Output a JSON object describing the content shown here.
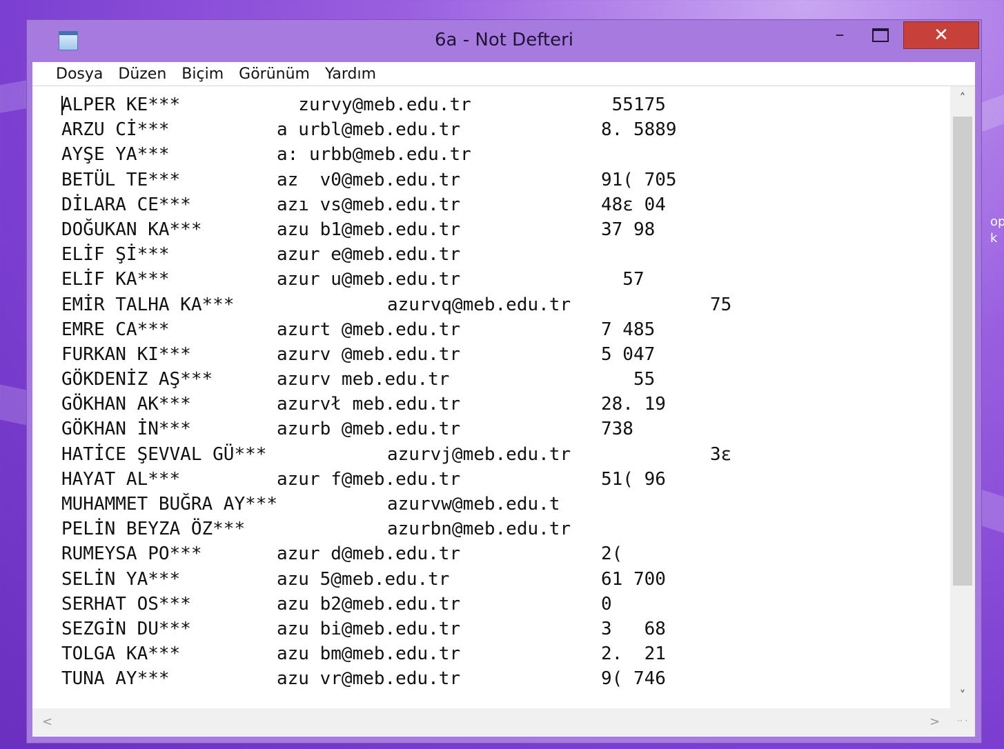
{
  "window": {
    "title": "6a - Not Defteri",
    "min_glyph": "–",
    "close_glyph": "✕"
  },
  "menu": [
    "Dosya",
    "Düzen",
    "Biçim",
    "Görünüm",
    "Yardım"
  ],
  "rows": [
    {
      "name": "ALPER KE***",
      "email": "  zurvy@meb.edu.tr",
      "num": " 55175"
    },
    {
      "name": "ARZU Cİ***",
      "email": "a urbl@meb.edu.tr",
      "num": "8. 5889"
    },
    {
      "name": "AYŞE YA***",
      "email": "a: urbb@meb.edu.tr",
      "num": ""
    },
    {
      "name": "BETÜL TE***",
      "email": "az  v0@meb.edu.tr",
      "num": "91( 705"
    },
    {
      "name": "DİLARA CE***",
      "email": "azı vs@meb.edu.tr",
      "num": "48ε 04"
    },
    {
      "name": "DOĞUKAN KA***",
      "email": "azu b1@meb.edu.tr",
      "num": "37 98"
    },
    {
      "name": "ELİF Şİ***",
      "email": "azur e@meb.edu.tr",
      "num": ""
    },
    {
      "name": "ELİF KA***",
      "email": "azur u@meb.edu.tr",
      "num": "  57"
    },
    {
      "name": "EMİR TALHA KA***",
      "email": "azurvq@meb.edu.tr",
      "num": "75"
    },
    {
      "name": "EMRE CA***",
      "email": "azurt @meb.edu.tr",
      "num": "7 485"
    },
    {
      "name": "FURKAN KI***",
      "email": "azurv @meb.edu.tr",
      "num": "5 047"
    },
    {
      "name": "GÖKDENİZ AŞ***",
      "email": "azurv meb.edu.tr",
      "num": "   55"
    },
    {
      "name": "GÖKHAN AK***",
      "email": "azurvł meb.edu.tr",
      "num": "28. 19"
    },
    {
      "name": "GÖKHAN İN***",
      "email": "azurb @meb.edu.tr",
      "num": "738"
    },
    {
      "name": "HATİCE ŞEVVAL GÜ***",
      "email": "azurvj@meb.edu.tr",
      "num": "3ε"
    },
    {
      "name": "HAYAT AL***",
      "email": "azur f@meb.edu.tr",
      "num": "51( 96"
    },
    {
      "name": "MUHAMMET BUĞRA AY***",
      "email": "azurvw@meb.edu.t",
      "num": ""
    },
    {
      "name": "PELİN BEYZA ÖZ***",
      "email": "azurbn@meb.edu.tr",
      "num": ""
    },
    {
      "name": "RUMEYSA PO***",
      "email": "azur d@meb.edu.tr",
      "num": "2("
    },
    {
      "name": "SELİN YA***",
      "email": "azu 5@meb.edu.tr",
      "num": "61 700"
    },
    {
      "name": "SERHAT OS***",
      "email": "azu b2@meb.edu.tr",
      "num": "0"
    },
    {
      "name": "SEZGİN DU***",
      "email": "azu bi@meb.edu.tr",
      "num": "3   68"
    },
    {
      "name": "TOLGA KA***",
      "email": "azu bm@meb.edu.tr",
      "num": "2.  21"
    },
    {
      "name": "TUNA AY***",
      "email": "azu vr@meb.edu.tr",
      "num": "9( 746"
    }
  ],
  "scroll": {
    "up": "˄",
    "down": "˅",
    "left": "<",
    "right": ">"
  },
  "desktop_text": "op k"
}
